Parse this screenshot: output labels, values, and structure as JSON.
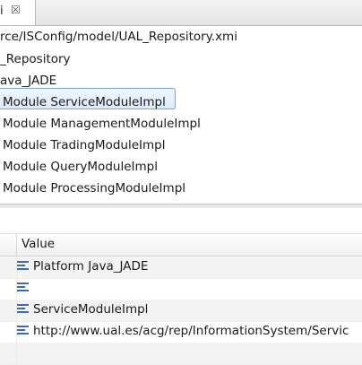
{
  "editor": {
    "tab_label": "i",
    "tab_close": "☒",
    "tree_rows": [
      "rce/ISConfig/model/UAL_Repository.xmi",
      "_Repository",
      "ava_JADE",
      "Module ServiceModuleImpl",
      "Module ManagementModuleImpl",
      "Module TradingModuleImpl",
      "Module QueryModuleImpl",
      "Module ProcessingModuleImpl"
    ]
  },
  "properties": {
    "value_header": "Value",
    "rows": [
      "Platform Java_JADE",
      "",
      "ServiceModuleImpl",
      "http://www.ual.es/acg/rep/InformationSystem/Servic"
    ]
  }
}
